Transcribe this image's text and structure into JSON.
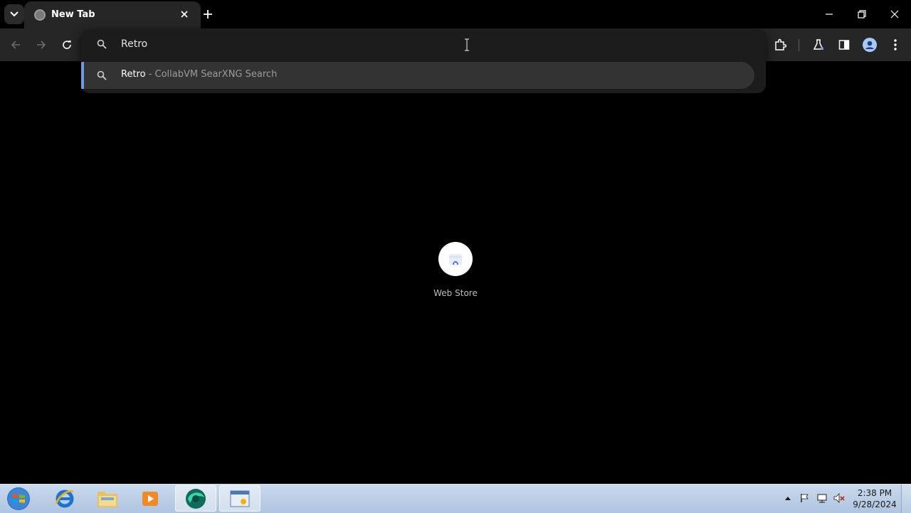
{
  "browser": {
    "tab": {
      "title": "New Tab"
    },
    "omnibox": {
      "input_value": "Retro",
      "suggestion": {
        "query": "Retro",
        "separator": " - ",
        "source": "CollabVM SearXNG Search"
      }
    },
    "accent_color": "#6e9be8"
  },
  "new_tab_page": {
    "shortcuts": [
      {
        "label": "Web Store"
      }
    ]
  },
  "taskbar": {
    "clock": {
      "time": "2:38 PM",
      "date": "9/28/2024"
    },
    "apps": [
      "start-orb",
      "internet-explorer",
      "file-explorer",
      "media-player",
      "browser",
      "remote-app"
    ]
  }
}
